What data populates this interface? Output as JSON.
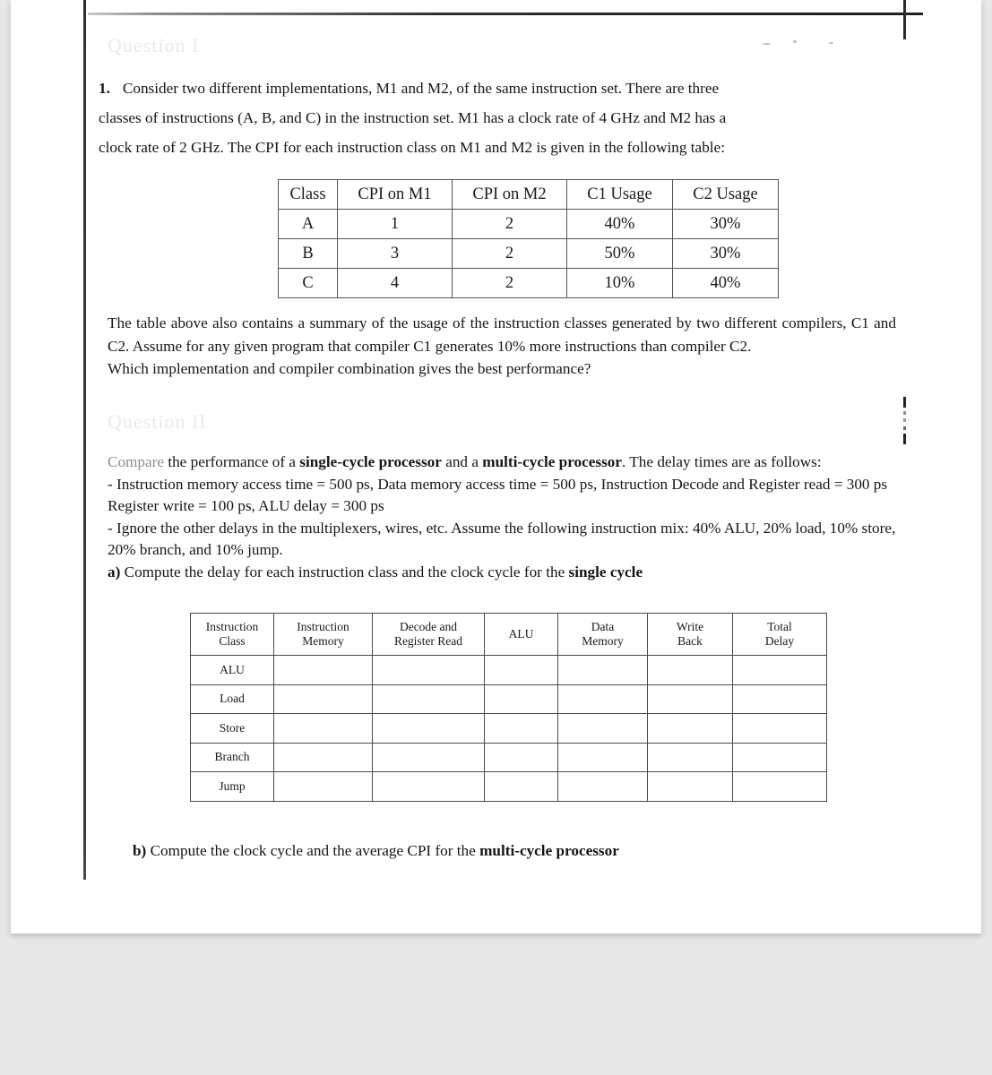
{
  "document": {
    "type": "scanned-exam-page",
    "background_color": "#e7e7e7",
    "page_color": "#ffffff"
  },
  "ghost_headings": {
    "question1": "Question I",
    "question2": "Question II"
  },
  "question1": {
    "number": "1.",
    "line1": "Consider two different implementations, M1 and M2, of the same instruction set. There are three",
    "line2": "classes of instructions (A, B, and C) in the instruction set. M1 has a clock rate of 4 GHz and M2 has a",
    "line3": "clock rate of 2 GHz. The CPI for each instruction class on M1 and M2 is given in the following table:"
  },
  "table1": {
    "headers": [
      "Class",
      "CPI on M1",
      "CPI on M2",
      "C1 Usage",
      "C2 Usage"
    ],
    "rows": [
      [
        "A",
        "1",
        "2",
        "40%",
        "30%"
      ],
      [
        "B",
        "3",
        "2",
        "50%",
        "30%"
      ],
      [
        "C",
        "4",
        "2",
        "10%",
        "40%"
      ]
    ]
  },
  "after_table": {
    "paragraph": "The table above also contains a summary of the usage of the instruction classes generated by two different compilers, C1 and C2. Assume for any given program that compiler C1 generates 10% more instructions than compiler C2.",
    "question_faded": "Which",
    "question_rest": " implementation and compiler combination gives the best performance?"
  },
  "question2": {
    "intro_faded": "Compare",
    "intro_part1": " the performance of a ",
    "bold1": "single-cycle processor",
    "intro_part2": " and a ",
    "bold2": "multi-cycle processor",
    "intro_part3": ". The delay times are as follows:",
    "bullet1": "- Instruction memory access time = 500 ps,  Data memory access time = 500 ps, Instruction Decode and Register read = 300 ps Register write = 100 ps, ALU delay = 300 ps",
    "bullet2": "- Ignore the other delays in the multiplexers, wires, etc. Assume the following instruction mix: 40% ALU, 20% load, 10% store, 20% branch, and 10% jump.",
    "part_a_label": "a)",
    "part_a_text": " Compute the delay for each instruction class and the clock cycle for the ",
    "part_a_bold": "single cycle"
  },
  "table2": {
    "headers": [
      {
        "line1": "Instruction",
        "line2": "Class"
      },
      {
        "line1": "Instruction",
        "line2": "Memory"
      },
      {
        "line1": "Decode and",
        "line2": "Register Read"
      },
      {
        "line1": "ALU",
        "line2": ""
      },
      {
        "line1": "Data",
        "line2": "Memory"
      },
      {
        "line1": "Write",
        "line2": "Back"
      },
      {
        "line1": "Total",
        "line2": "Delay"
      }
    ],
    "rows": [
      {
        "label": "ALU",
        "cells": [
          "",
          "",
          "",
          "",
          "",
          ""
        ]
      },
      {
        "label": "Load",
        "cells": [
          "",
          "",
          "",
          "",
          "",
          ""
        ]
      },
      {
        "label": "Store",
        "cells": [
          "",
          "",
          "",
          "",
          "",
          ""
        ]
      },
      {
        "label": "Branch",
        "cells": [
          "",
          "",
          "",
          "",
          "",
          ""
        ]
      },
      {
        "label": "Jump",
        "cells": [
          "",
          "",
          "",
          "",
          "",
          ""
        ]
      }
    ]
  },
  "part_b": {
    "label": "b)",
    "text": " Compute the clock cycle and the average CPI for the ",
    "bold": "multi-cycle processor"
  }
}
